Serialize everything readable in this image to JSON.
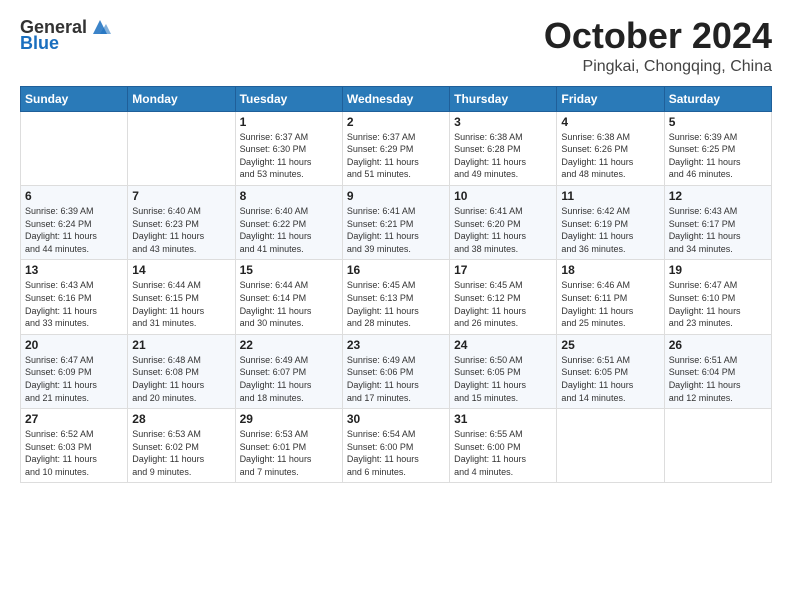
{
  "header": {
    "logo": {
      "text_general": "General",
      "text_blue": "Blue"
    },
    "month": "October 2024",
    "location": "Pingkai, Chongqing, China"
  },
  "calendar": {
    "headers": [
      "Sunday",
      "Monday",
      "Tuesday",
      "Wednesday",
      "Thursday",
      "Friday",
      "Saturday"
    ],
    "rows": [
      [
        {
          "day": "",
          "content": ""
        },
        {
          "day": "",
          "content": ""
        },
        {
          "day": "1",
          "content": "Sunrise: 6:37 AM\nSunset: 6:30 PM\nDaylight: 11 hours\nand 53 minutes."
        },
        {
          "day": "2",
          "content": "Sunrise: 6:37 AM\nSunset: 6:29 PM\nDaylight: 11 hours\nand 51 minutes."
        },
        {
          "day": "3",
          "content": "Sunrise: 6:38 AM\nSunset: 6:28 PM\nDaylight: 11 hours\nand 49 minutes."
        },
        {
          "day": "4",
          "content": "Sunrise: 6:38 AM\nSunset: 6:26 PM\nDaylight: 11 hours\nand 48 minutes."
        },
        {
          "day": "5",
          "content": "Sunrise: 6:39 AM\nSunset: 6:25 PM\nDaylight: 11 hours\nand 46 minutes."
        }
      ],
      [
        {
          "day": "6",
          "content": "Sunrise: 6:39 AM\nSunset: 6:24 PM\nDaylight: 11 hours\nand 44 minutes."
        },
        {
          "day": "7",
          "content": "Sunrise: 6:40 AM\nSunset: 6:23 PM\nDaylight: 11 hours\nand 43 minutes."
        },
        {
          "day": "8",
          "content": "Sunrise: 6:40 AM\nSunset: 6:22 PM\nDaylight: 11 hours\nand 41 minutes."
        },
        {
          "day": "9",
          "content": "Sunrise: 6:41 AM\nSunset: 6:21 PM\nDaylight: 11 hours\nand 39 minutes."
        },
        {
          "day": "10",
          "content": "Sunrise: 6:41 AM\nSunset: 6:20 PM\nDaylight: 11 hours\nand 38 minutes."
        },
        {
          "day": "11",
          "content": "Sunrise: 6:42 AM\nSunset: 6:19 PM\nDaylight: 11 hours\nand 36 minutes."
        },
        {
          "day": "12",
          "content": "Sunrise: 6:43 AM\nSunset: 6:17 PM\nDaylight: 11 hours\nand 34 minutes."
        }
      ],
      [
        {
          "day": "13",
          "content": "Sunrise: 6:43 AM\nSunset: 6:16 PM\nDaylight: 11 hours\nand 33 minutes."
        },
        {
          "day": "14",
          "content": "Sunrise: 6:44 AM\nSunset: 6:15 PM\nDaylight: 11 hours\nand 31 minutes."
        },
        {
          "day": "15",
          "content": "Sunrise: 6:44 AM\nSunset: 6:14 PM\nDaylight: 11 hours\nand 30 minutes."
        },
        {
          "day": "16",
          "content": "Sunrise: 6:45 AM\nSunset: 6:13 PM\nDaylight: 11 hours\nand 28 minutes."
        },
        {
          "day": "17",
          "content": "Sunrise: 6:45 AM\nSunset: 6:12 PM\nDaylight: 11 hours\nand 26 minutes."
        },
        {
          "day": "18",
          "content": "Sunrise: 6:46 AM\nSunset: 6:11 PM\nDaylight: 11 hours\nand 25 minutes."
        },
        {
          "day": "19",
          "content": "Sunrise: 6:47 AM\nSunset: 6:10 PM\nDaylight: 11 hours\nand 23 minutes."
        }
      ],
      [
        {
          "day": "20",
          "content": "Sunrise: 6:47 AM\nSunset: 6:09 PM\nDaylight: 11 hours\nand 21 minutes."
        },
        {
          "day": "21",
          "content": "Sunrise: 6:48 AM\nSunset: 6:08 PM\nDaylight: 11 hours\nand 20 minutes."
        },
        {
          "day": "22",
          "content": "Sunrise: 6:49 AM\nSunset: 6:07 PM\nDaylight: 11 hours\nand 18 minutes."
        },
        {
          "day": "23",
          "content": "Sunrise: 6:49 AM\nSunset: 6:06 PM\nDaylight: 11 hours\nand 17 minutes."
        },
        {
          "day": "24",
          "content": "Sunrise: 6:50 AM\nSunset: 6:05 PM\nDaylight: 11 hours\nand 15 minutes."
        },
        {
          "day": "25",
          "content": "Sunrise: 6:51 AM\nSunset: 6:05 PM\nDaylight: 11 hours\nand 14 minutes."
        },
        {
          "day": "26",
          "content": "Sunrise: 6:51 AM\nSunset: 6:04 PM\nDaylight: 11 hours\nand 12 minutes."
        }
      ],
      [
        {
          "day": "27",
          "content": "Sunrise: 6:52 AM\nSunset: 6:03 PM\nDaylight: 11 hours\nand 10 minutes."
        },
        {
          "day": "28",
          "content": "Sunrise: 6:53 AM\nSunset: 6:02 PM\nDaylight: 11 hours\nand 9 minutes."
        },
        {
          "day": "29",
          "content": "Sunrise: 6:53 AM\nSunset: 6:01 PM\nDaylight: 11 hours\nand 7 minutes."
        },
        {
          "day": "30",
          "content": "Sunrise: 6:54 AM\nSunset: 6:00 PM\nDaylight: 11 hours\nand 6 minutes."
        },
        {
          "day": "31",
          "content": "Sunrise: 6:55 AM\nSunset: 6:00 PM\nDaylight: 11 hours\nand 4 minutes."
        },
        {
          "day": "",
          "content": ""
        },
        {
          "day": "",
          "content": ""
        }
      ]
    ]
  }
}
